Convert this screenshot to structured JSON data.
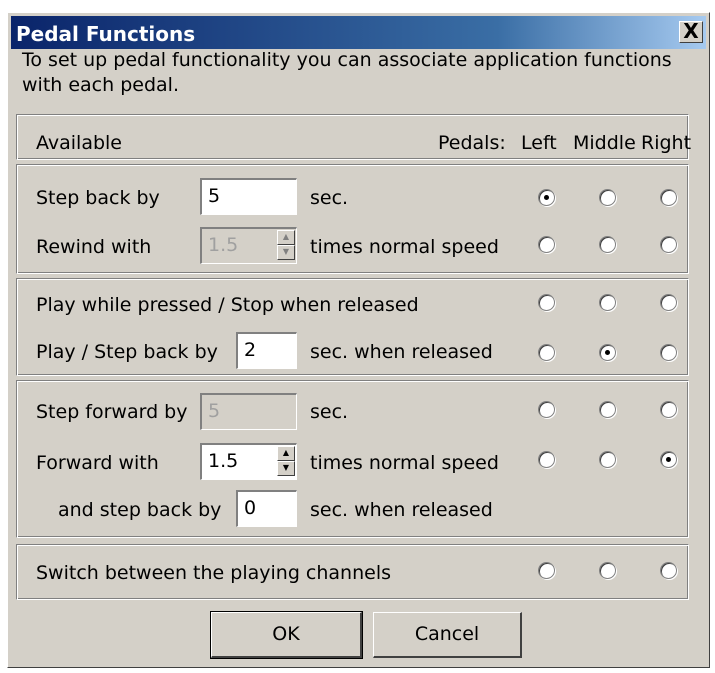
{
  "dialog": {
    "title": "Pedal Functions",
    "close_glyph": "X",
    "intro": "To set up pedal functionality you can associate application functions with each pedal."
  },
  "header": {
    "available": "Available",
    "pedals": "Pedals:",
    "left": "Left",
    "middle": "Middle",
    "right": "Right"
  },
  "group1": {
    "step_back_label": "Step back by",
    "step_back_value": "5",
    "step_back_unit": "sec.",
    "rewind_label": "Rewind with",
    "rewind_value": "1.5",
    "rewind_unit": "times normal speed"
  },
  "group2": {
    "play_pressed_label": "Play while pressed / Stop when released",
    "play_step_label": "Play / Step back by",
    "play_step_value": "2",
    "play_step_unit": "sec. when released"
  },
  "group3": {
    "step_forward_label": "Step forward by",
    "step_forward_value": "5",
    "step_forward_unit": "sec.",
    "forward_label": "Forward with",
    "forward_value": "1.5",
    "forward_unit": "times normal speed",
    "and_step_back_label": "and step back by",
    "and_step_back_value": "0",
    "and_step_back_unit": "sec. when released"
  },
  "group4": {
    "switch_label": "Switch between the playing channels"
  },
  "selections": {
    "step_back": "left",
    "rewind": "none",
    "play_pressed": "none",
    "play_step": "middle",
    "step_forward": "none",
    "forward": "right",
    "switch": "none"
  },
  "buttons": {
    "ok": "OK",
    "cancel": "Cancel"
  }
}
